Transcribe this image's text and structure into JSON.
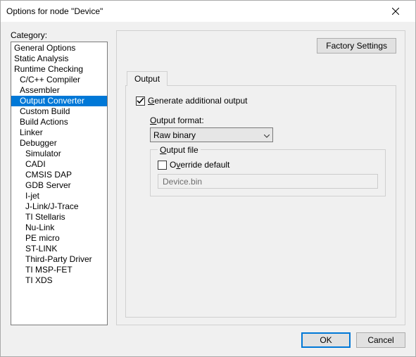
{
  "title": "Options for node \"Device\"",
  "labels": {
    "category": "Category:",
    "factory_settings": "Factory Settings",
    "ok": "OK",
    "cancel": "Cancel"
  },
  "categories": [
    {
      "label": "General Options",
      "indent": 0,
      "selected": false
    },
    {
      "label": "Static Analysis",
      "indent": 0,
      "selected": false
    },
    {
      "label": "Runtime Checking",
      "indent": 0,
      "selected": false
    },
    {
      "label": "C/C++ Compiler",
      "indent": 1,
      "selected": false
    },
    {
      "label": "Assembler",
      "indent": 1,
      "selected": false
    },
    {
      "label": "Output Converter",
      "indent": 1,
      "selected": true
    },
    {
      "label": "Custom Build",
      "indent": 1,
      "selected": false
    },
    {
      "label": "Build Actions",
      "indent": 1,
      "selected": false
    },
    {
      "label": "Linker",
      "indent": 1,
      "selected": false
    },
    {
      "label": "Debugger",
      "indent": 1,
      "selected": false
    },
    {
      "label": "Simulator",
      "indent": 2,
      "selected": false
    },
    {
      "label": "CADI",
      "indent": 2,
      "selected": false
    },
    {
      "label": "CMSIS DAP",
      "indent": 2,
      "selected": false
    },
    {
      "label": "GDB Server",
      "indent": 2,
      "selected": false
    },
    {
      "label": "I-jet",
      "indent": 2,
      "selected": false
    },
    {
      "label": "J-Link/J-Trace",
      "indent": 2,
      "selected": false
    },
    {
      "label": "TI Stellaris",
      "indent": 2,
      "selected": false
    },
    {
      "label": "Nu-Link",
      "indent": 2,
      "selected": false
    },
    {
      "label": "PE micro",
      "indent": 2,
      "selected": false
    },
    {
      "label": "ST-LINK",
      "indent": 2,
      "selected": false
    },
    {
      "label": "Third-Party Driver",
      "indent": 2,
      "selected": false
    },
    {
      "label": "TI MSP-FET",
      "indent": 2,
      "selected": false
    },
    {
      "label": "TI XDS",
      "indent": 2,
      "selected": false
    }
  ],
  "tab": {
    "label": "Output"
  },
  "form": {
    "generate_label": "Generate additional output",
    "generate_checked": true,
    "output_format_label": "Output format:",
    "output_format_value": "Raw binary",
    "output_file_legend": "Output file",
    "override_label": "Override default",
    "override_checked": false,
    "output_file_value": "Device.bin"
  }
}
